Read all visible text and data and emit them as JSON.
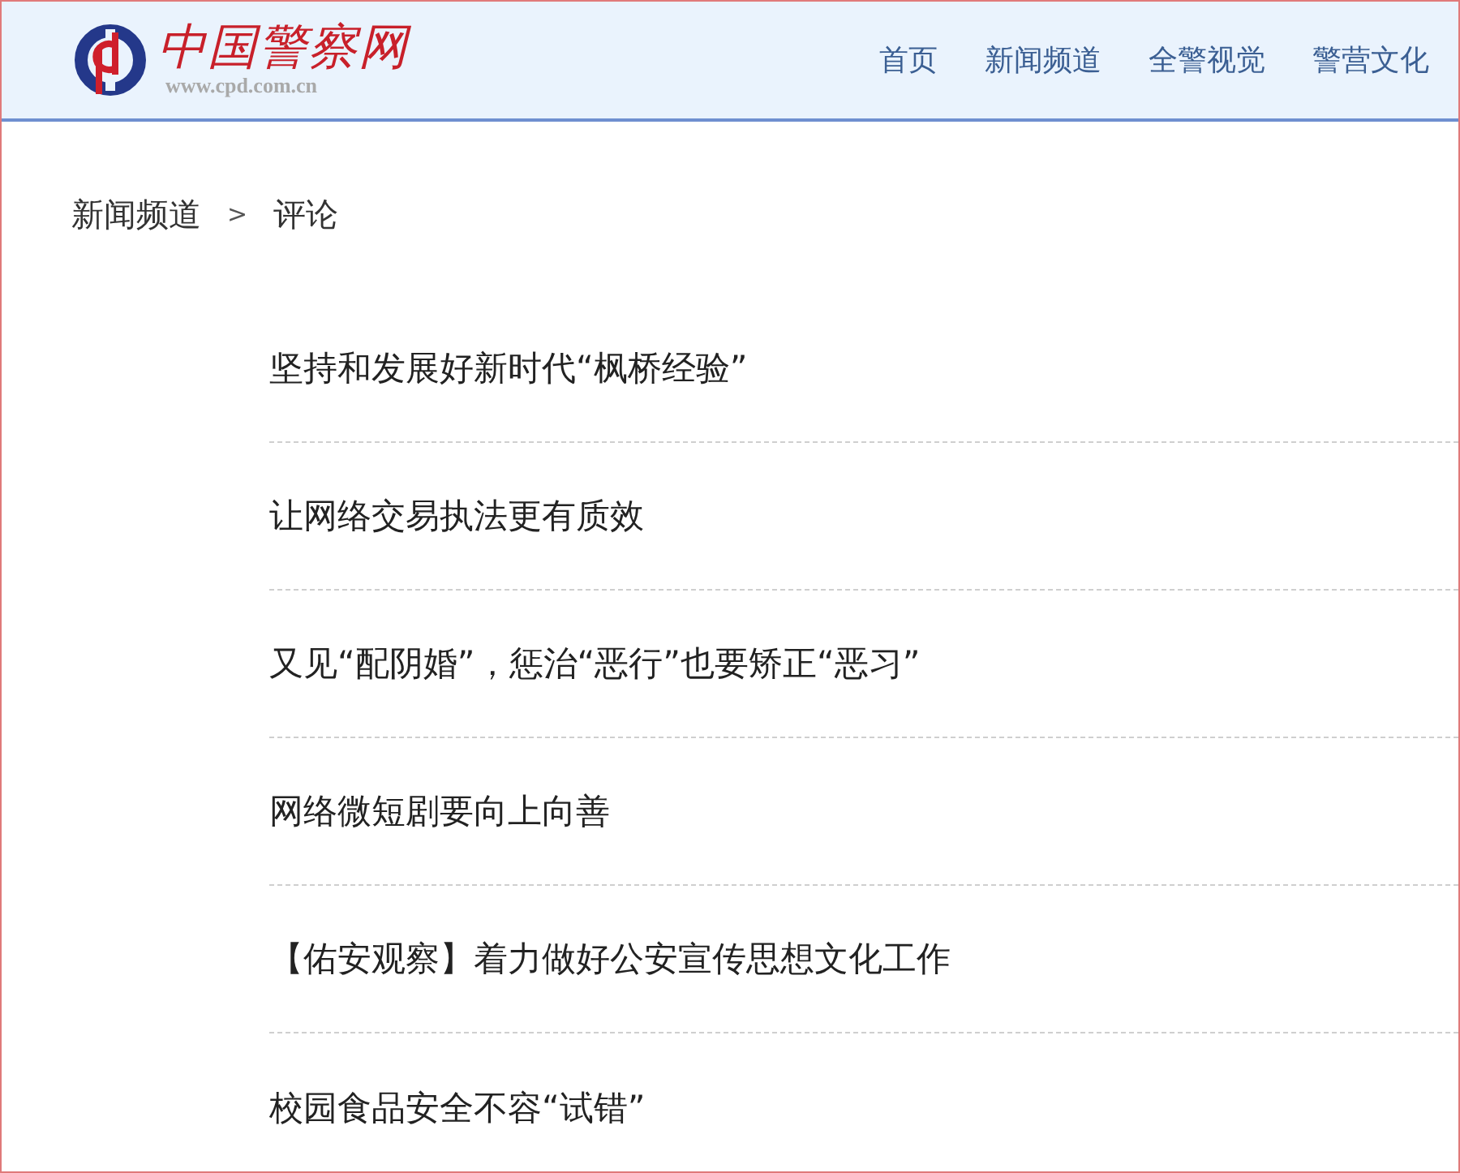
{
  "header": {
    "logo_title": "中国警察网",
    "logo_url": "www.cpd.com.cn",
    "nav": [
      {
        "label": "首页"
      },
      {
        "label": "新闻频道"
      },
      {
        "label": "全警视觉"
      },
      {
        "label": "警营文化"
      }
    ]
  },
  "breadcrumb": {
    "items": [
      "新闻频道",
      "评论"
    ],
    "separator": ">"
  },
  "articles": [
    {
      "title": "坚持和发展好新时代“枫桥经验”"
    },
    {
      "title": "让网络交易执法更有质效"
    },
    {
      "title": "又见“配阴婚”，惩治“恶行”也要矫正“恶习”"
    },
    {
      "title": "网络微短剧要向上向善"
    },
    {
      "title": "【佑安观察】着力做好公安宣传思想文化工作"
    },
    {
      "title": "校园食品安全不容“试错”"
    }
  ]
}
